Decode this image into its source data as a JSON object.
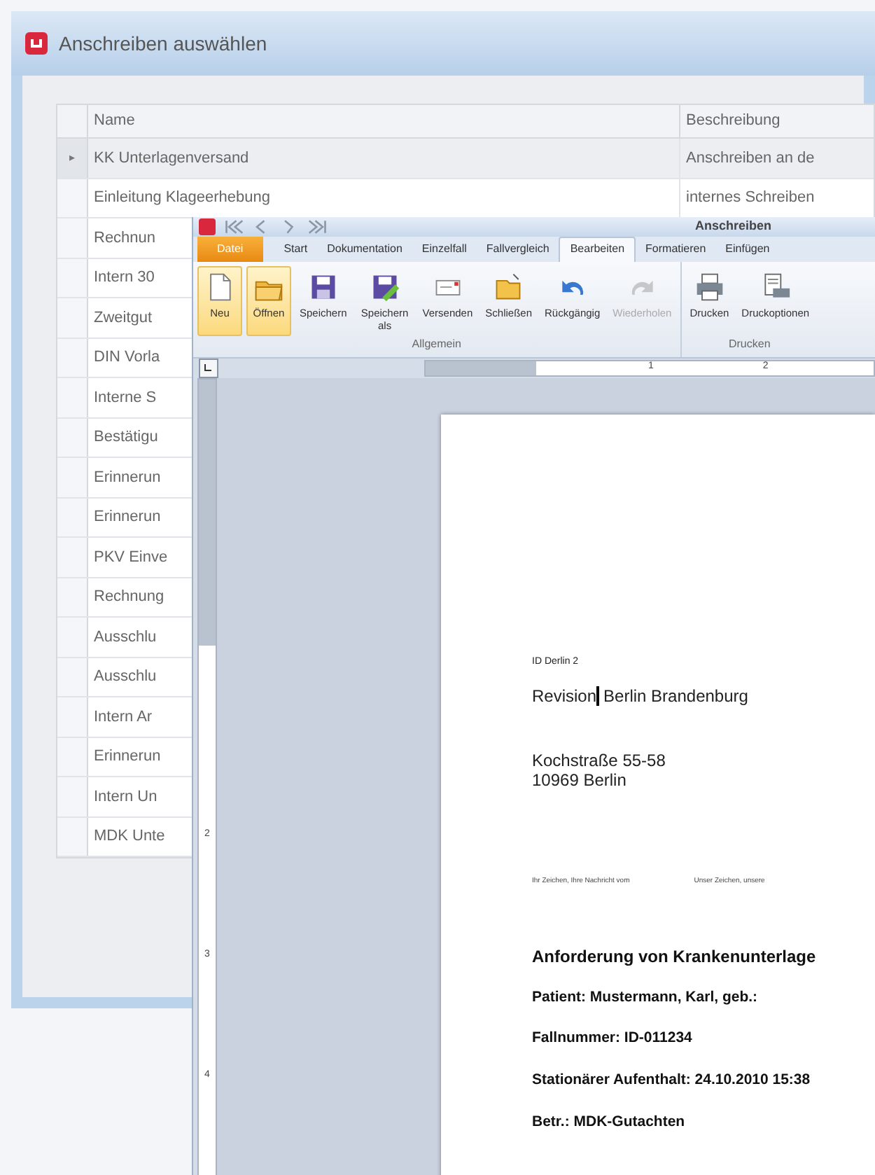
{
  "back_window": {
    "title": "Anschreiben auswählen",
    "table": {
      "columns": [
        "Name",
        "Beschreibung"
      ],
      "rows": [
        {
          "name": "KK Unterlagenversand",
          "description": "Anschreiben an de",
          "indicator": "▸",
          "selected": true
        },
        {
          "name": "Einleitung Klageerhebung",
          "description": "internes Schreiben",
          "selected": false
        },
        {
          "name": "Rechnun",
          "selected": false
        },
        {
          "name": "Intern 30",
          "selected": false
        },
        {
          "name": "Zweitgut",
          "selected": false
        },
        {
          "name": "DIN Vorla",
          "selected": false
        },
        {
          "name": "Interne S",
          "selected": false
        },
        {
          "name": "Bestätigu",
          "selected": false
        },
        {
          "name": "Erinnerun",
          "selected": false
        },
        {
          "name": "Erinnerun",
          "selected": false
        },
        {
          "name": "PKV Einve",
          "selected": false
        },
        {
          "name": "Rechnung",
          "selected": false
        },
        {
          "name": "Ausschlu",
          "selected": false
        },
        {
          "name": "Ausschlu",
          "selected": false
        },
        {
          "name": "Intern Ar",
          "selected": false
        },
        {
          "name": "Erinnerun",
          "selected": false
        },
        {
          "name": "Intern Un",
          "selected": false
        },
        {
          "name": "MDK Unte",
          "selected": false
        }
      ]
    }
  },
  "editor_window": {
    "title": "Anschreiben",
    "tabs": [
      {
        "label": "Datei",
        "kind": "file",
        "selected": false
      },
      {
        "label": "Start",
        "kind": "tab",
        "selected": false
      },
      {
        "label": "Dokumentation",
        "kind": "tab",
        "selected": false
      },
      {
        "label": "Einzelfall",
        "kind": "tab",
        "selected": false
      },
      {
        "label": "Fallvergleich",
        "kind": "tab",
        "selected": false
      },
      {
        "label": "Bearbeiten",
        "kind": "tab",
        "selected": true
      },
      {
        "label": "Formatieren",
        "kind": "tab",
        "selected": false
      },
      {
        "label": "Einfügen",
        "kind": "tab",
        "selected": false
      }
    ],
    "ribbon_groups": [
      {
        "label": "Allgemein",
        "buttons": [
          {
            "label": "Neu",
            "highlighted": true,
            "disabled": false
          },
          {
            "label": "Öffnen",
            "highlighted": true,
            "disabled": false
          },
          {
            "label": "Speichern",
            "highlighted": false,
            "disabled": false
          },
          {
            "label": "Speichern als",
            "highlighted": false,
            "disabled": false
          },
          {
            "label": "Versenden",
            "highlighted": false,
            "disabled": false
          },
          {
            "label": "Schließen",
            "highlighted": false,
            "disabled": false
          },
          {
            "label": "Rückgängig",
            "highlighted": false,
            "disabled": false
          },
          {
            "label": "Wiederholen",
            "highlighted": false,
            "disabled": true
          }
        ]
      },
      {
        "label": "Drucken",
        "buttons": [
          {
            "label": "Drucken",
            "highlighted": false,
            "disabled": false
          },
          {
            "label": "Druckoptionen",
            "highlighted": false,
            "disabled": false
          }
        ]
      }
    ],
    "ruler": {
      "labels": [
        "1",
        "2"
      ]
    },
    "vertical_ruler": {
      "labels": [
        "2",
        "3",
        "4"
      ]
    },
    "document": [
      {
        "kind": "small",
        "text": "ID Derlin 2"
      },
      {
        "kind": "caret_line",
        "before": "Revision",
        "after": "Berlin Brandenburg"
      },
      {
        "kind": "address",
        "lines": [
          "Kochstraße 55-58",
          "10969 Berlin"
        ]
      },
      {
        "kind": "reference",
        "texts": [
          "Ihr Zeichen, Ihre Nachricht vom",
          "Unser Zeichen, unsere"
        ]
      },
      {
        "kind": "heading",
        "text": "Anforderung von Krankenunterlage"
      },
      {
        "kind": "bold",
        "text": "Patient: Mustermann, Karl, geb.:"
      },
      {
        "kind": "bold",
        "text": "Fallnummer: ID-011234"
      },
      {
        "kind": "bold",
        "text": "Stationärer Aufenthalt: 24.10.2010 15:38"
      },
      {
        "kind": "bold",
        "text": "Betr.: MDK-Gutachten"
      }
    ]
  }
}
